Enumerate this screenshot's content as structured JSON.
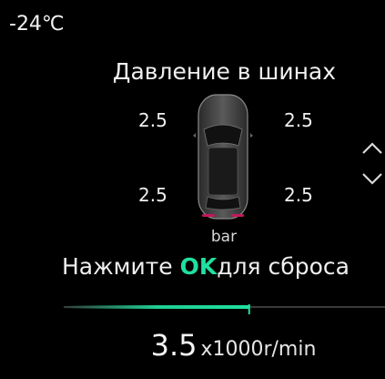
{
  "status": {
    "temperature": "-24℃"
  },
  "tpms": {
    "title": "Давление в шинах",
    "front_left": "2.5",
    "front_right": "2.5",
    "rear_left": "2.5",
    "rear_right": "2.5",
    "unit": "bar",
    "hint_before": "Нажмите",
    "hint_key": "OK",
    "hint_after": "для сброса"
  },
  "tach": {
    "value": "3.5",
    "unit": "x1000r/min",
    "level": 0.58
  },
  "icons": {
    "nav_up": "chevron-up-icon",
    "nav_down": "chevron-down-icon",
    "car": "car-top-view-icon"
  },
  "colors": {
    "accent": "#1fe0a0",
    "tail_light": "#c2185b"
  }
}
